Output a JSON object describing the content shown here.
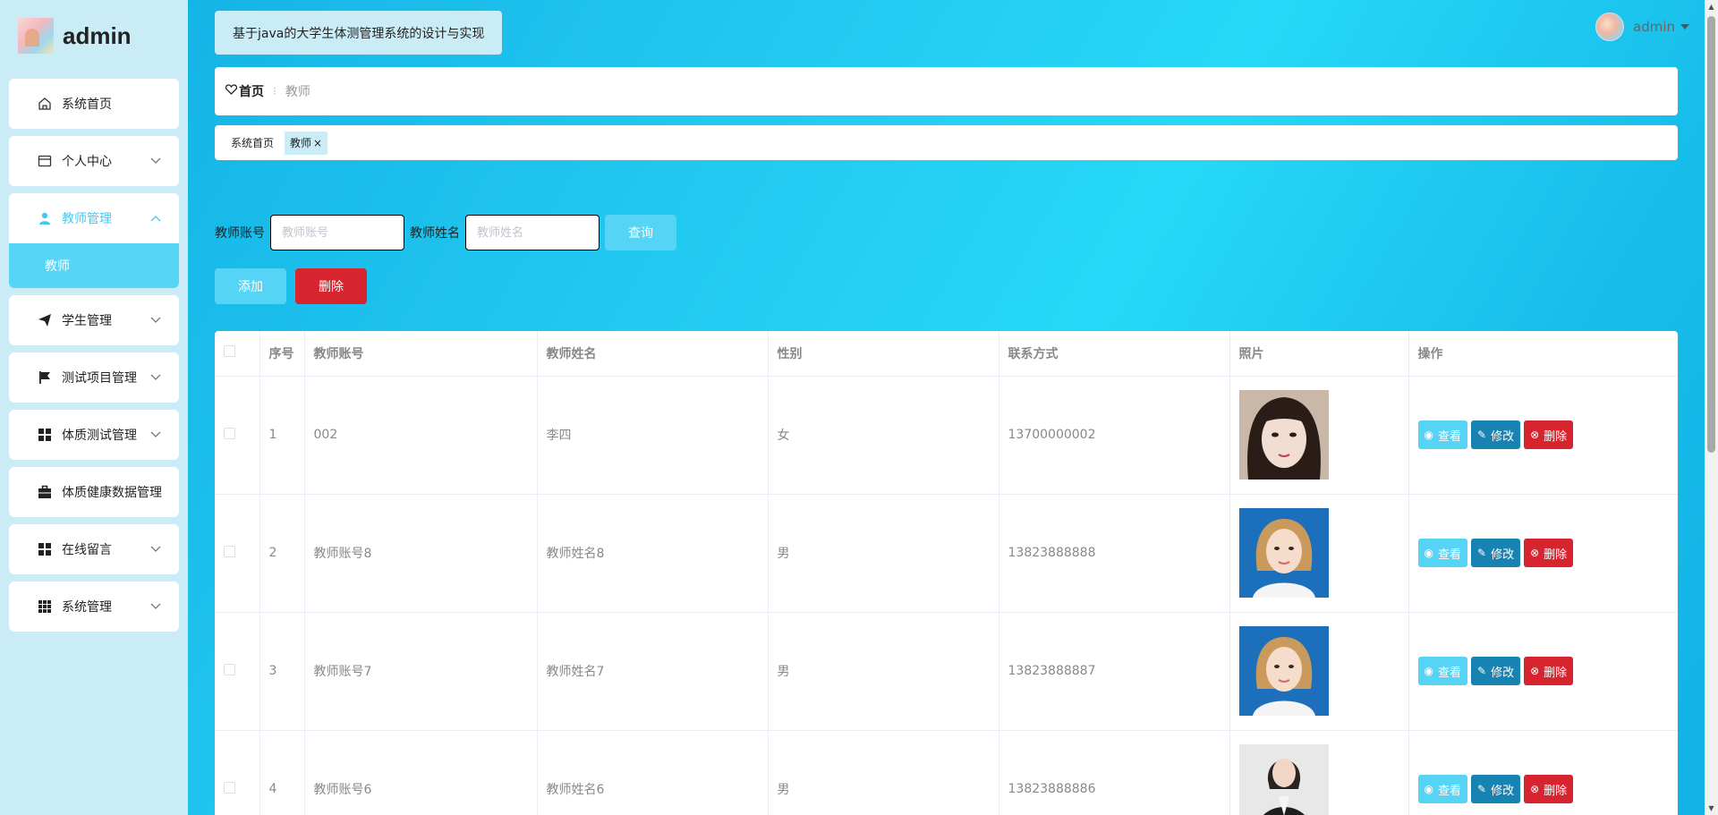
{
  "brand": {
    "name": "admin"
  },
  "sidebar": {
    "items": [
      {
        "label": "系统首页",
        "icon": "home-icon"
      },
      {
        "label": "个人中心",
        "icon": "card-icon"
      },
      {
        "label": "教师管理",
        "icon": "user-icon",
        "sub": [
          "教师"
        ]
      },
      {
        "label": "学生管理",
        "icon": "paper-plane-icon"
      },
      {
        "label": "测试项目管理",
        "icon": "flag-icon"
      },
      {
        "label": "体质测试管理",
        "icon": "grid-icon"
      },
      {
        "label": "体质健康数据管理",
        "icon": "briefcase-icon"
      },
      {
        "label": "在线留言",
        "icon": "grid-icon"
      },
      {
        "label": "系统管理",
        "icon": "apps-icon"
      }
    ]
  },
  "header": {
    "title": "基于java的大学生体测管理系统的设计与实现",
    "user": "admin"
  },
  "breadcrumb": {
    "home": "首页",
    "current": "教师"
  },
  "tags": {
    "home": "系统首页",
    "active": "教师"
  },
  "search": {
    "account_label": "教师账号",
    "account_placeholder": "教师账号",
    "name_label": "教师姓名",
    "name_placeholder": "教师姓名",
    "query": "查询"
  },
  "actions": {
    "add": "添加",
    "delete": "删除"
  },
  "table": {
    "headers": [
      "序号",
      "教师账号",
      "教师姓名",
      "性别",
      "联系方式",
      "照片",
      "操作"
    ],
    "rows": [
      {
        "no": "1",
        "account": "002",
        "name": "李四",
        "gender": "女",
        "phone": "13700000002"
      },
      {
        "no": "2",
        "account": "教师账号8",
        "name": "教师姓名8",
        "gender": "男",
        "phone": "13823888888"
      },
      {
        "no": "3",
        "account": "教师账号7",
        "name": "教师姓名7",
        "gender": "男",
        "phone": "13823888887"
      },
      {
        "no": "4",
        "account": "教师账号6",
        "name": "教师姓名6",
        "gender": "男",
        "phone": "13823888886"
      }
    ],
    "ops": {
      "view": "查看",
      "edit": "修改",
      "delete": "删除"
    }
  },
  "colors": {
    "accent": "#55d4f5",
    "edit": "#1683b3",
    "danger": "#d6252e",
    "sidebar_bg": "#c9ecf6"
  }
}
